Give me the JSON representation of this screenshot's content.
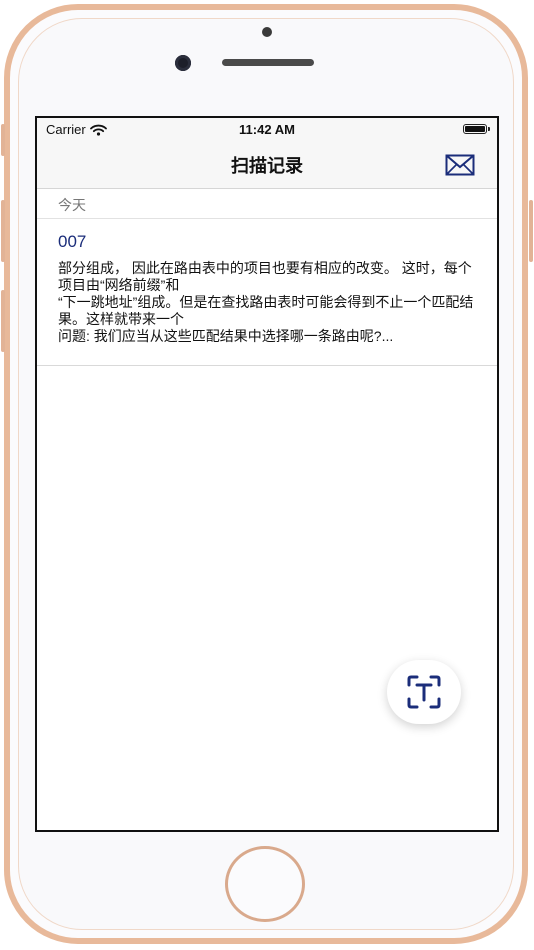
{
  "status_bar": {
    "carrier": "Carrier",
    "time": "11:42 AM",
    "battery_level": 1.0
  },
  "nav": {
    "title": "扫描记录",
    "mail_icon": "envelope-icon"
  },
  "section": {
    "header": "今天"
  },
  "records": [
    {
      "title": "007",
      "body": "部分组成， 因此在路由表中的项目也要有相应的改变。 这时，每个项目由“网络前缀”和\n“下一跳地址”组成。但是在查找路由表时可能会得到不止一个匹配结果。这样就带来一个\n问题: 我们应当从这些匹配结果中选择哪一条路由呢?..."
    }
  ],
  "fab": {
    "icon": "text-scan-icon"
  },
  "colors": {
    "accent": "#1b2d7a",
    "phone_frame": "#e8b99a",
    "nav_background": "#f7f7f7"
  }
}
